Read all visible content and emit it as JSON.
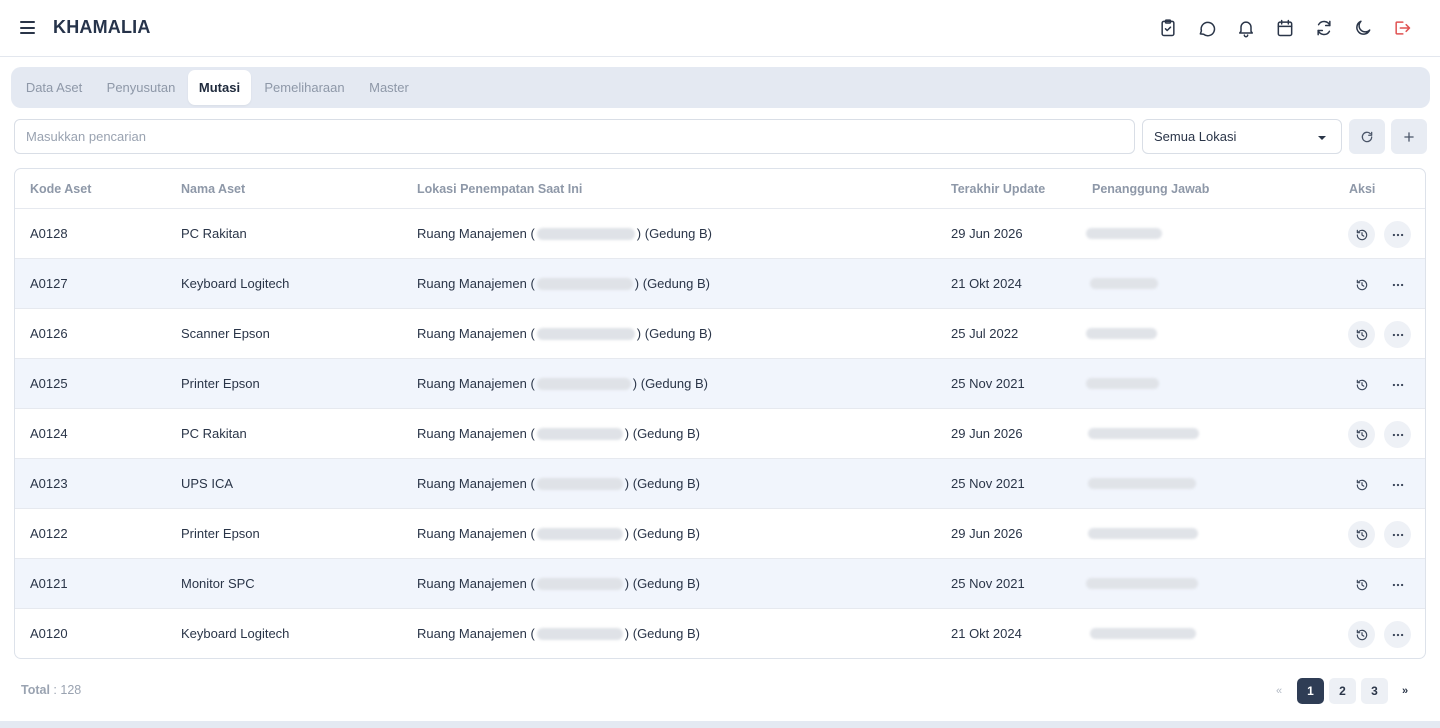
{
  "app": {
    "title": "KHAMALIA"
  },
  "header_icons": [
    "clipboard-check-icon",
    "chat-bubble-icon",
    "bell-icon",
    "calendar-icon",
    "refresh-icon",
    "moon-icon",
    "logout-icon"
  ],
  "tabs": [
    {
      "label": "Data Aset",
      "active": false
    },
    {
      "label": "Penyusutan",
      "active": false
    },
    {
      "label": "Mutasi",
      "active": true
    },
    {
      "label": "Pemeliharaan",
      "active": false
    },
    {
      "label": "Master",
      "active": false
    }
  ],
  "search": {
    "placeholder": "Masukkan pencarian",
    "value": ""
  },
  "location_filter": {
    "selected": "Semua Lokasi"
  },
  "table": {
    "columns": {
      "kode": "Kode Aset",
      "nama": "Nama Aset",
      "lokasi": "Lokasi Penempatan Saat Ini",
      "update": "Terakhir Update",
      "pj": "Penanggung Jawab",
      "aksi": "Aksi"
    },
    "rows": [
      {
        "kode": "A0128",
        "nama": "PC Rakitan",
        "lokasi_prefix": "Ruang Manajemen (",
        "lokasi_suffix": ") (Gedung B)",
        "update": "29 Jun 2026"
      },
      {
        "kode": "A0127",
        "nama": "Keyboard Logitech",
        "lokasi_prefix": "Ruang Manajemen (",
        "lokasi_suffix": ") (Gedung B)",
        "update": "21 Okt 2024"
      },
      {
        "kode": "A0126",
        "nama": "Scanner Epson",
        "lokasi_prefix": "Ruang Manajemen (",
        "lokasi_suffix": ") (Gedung B)",
        "update": "25 Jul 2022"
      },
      {
        "kode": "A0125",
        "nama": "Printer Epson",
        "lokasi_prefix": "Ruang Manajemen (",
        "lokasi_suffix": ") (Gedung B)",
        "update": "25 Nov 2021"
      },
      {
        "kode": "A0124",
        "nama": "PC Rakitan",
        "lokasi_prefix": "Ruang Manajemen (",
        "lokasi_suffix": ") (Gedung B)",
        "update": "29 Jun 2026"
      },
      {
        "kode": "A0123",
        "nama": "UPS ICA",
        "lokasi_prefix": "Ruang Manajemen (",
        "lokasi_suffix": ") (Gedung B)",
        "update": "25 Nov 2021"
      },
      {
        "kode": "A0122",
        "nama": "Printer Epson",
        "lokasi_prefix": "Ruang Manajemen (",
        "lokasi_suffix": ") (Gedung B)",
        "update": "29 Jun 2026"
      },
      {
        "kode": "A0121",
        "nama": "Monitor SPC",
        "lokasi_prefix": "Ruang Manajemen (",
        "lokasi_suffix": ") (Gedung B)",
        "update": "25 Nov 2021"
      },
      {
        "kode": "A0120",
        "nama": "Keyboard Logitech",
        "lokasi_prefix": "Ruang Manajemen (",
        "lokasi_suffix": ") (Gedung B)",
        "update": "21 Okt 2024"
      }
    ]
  },
  "footer": {
    "total_label": "Total",
    "total_value": ": 128",
    "pagination": {
      "prev": "«",
      "pages": [
        "1",
        "2",
        "3"
      ],
      "current": "1",
      "next": "»"
    }
  },
  "colors": {
    "accent": "#2f3d55",
    "logout": "#e05252",
    "row_alt": "#f1f5fc",
    "tab_bar": "#e4e9f2"
  }
}
